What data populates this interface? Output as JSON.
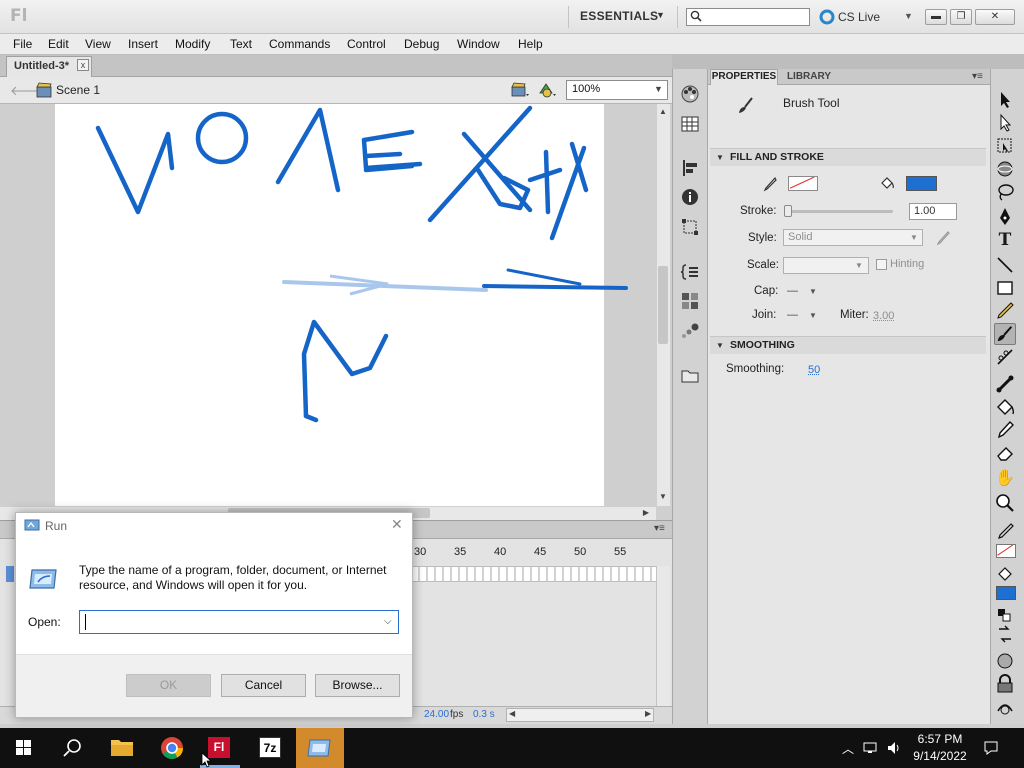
{
  "titlebar": {
    "logo": "Fl",
    "workspace": "ESSENTIALS",
    "search_placeholder": "",
    "cs_live": "CS Live",
    "minimize": "▬",
    "restore": "❐",
    "close": "✕"
  },
  "menu": [
    "File",
    "Edit",
    "View",
    "Insert",
    "Modify",
    "Text",
    "Commands",
    "Control",
    "Debug",
    "Window",
    "Help"
  ],
  "document": {
    "tab": "Untitled-3*",
    "tab_close": "x",
    "scene": "Scene 1",
    "zoom": "100%"
  },
  "timeline": {
    "frames": [
      "30",
      "35",
      "40",
      "45",
      "50",
      "55"
    ],
    "fps": "24.00",
    "fps_unit": "fps",
    "elapsed": "0.3 s"
  },
  "properties": {
    "tabs": [
      "PROPERTIES",
      "LIBRARY"
    ],
    "tool_name": "Brush Tool",
    "fill_stroke_title": "FILL AND STROKE",
    "stroke_label": "Stroke:",
    "stroke_value": "1.00",
    "style_label": "Style:",
    "style_value": "Solid",
    "scale_label": "Scale:",
    "hinting_label": "Hinting",
    "cap_label": "Cap:",
    "join_label": "Join:",
    "miter_label": "Miter:",
    "miter_value": "3.00",
    "smoothing_title": "SMOOTHING",
    "smoothing_label": "Smoothing:",
    "smoothing_value": "50",
    "fill_color": "#1e6fd2"
  },
  "run_dialog": {
    "title": "Run",
    "description": "Type the name of a program, folder, document, or Internet resource, and Windows will open it for you.",
    "open_label": "Open:",
    "open_value": "",
    "ok": "OK",
    "cancel": "Cancel",
    "browse": "Browse..."
  },
  "taskbar": {
    "time": "6:57 PM",
    "date": "9/14/2022",
    "flash_label": "Fl",
    "sevenzip_label": "7z"
  }
}
